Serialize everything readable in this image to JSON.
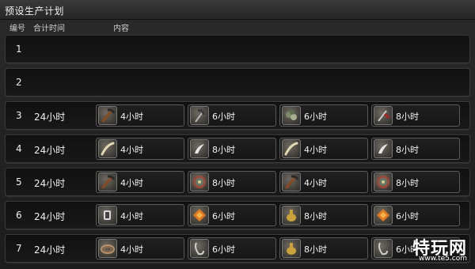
{
  "window": {
    "title": "预设生产计划"
  },
  "headers": {
    "num": "编号",
    "time": "合计时间",
    "content": "内容"
  },
  "rows": [
    {
      "num": "1",
      "total": "",
      "items": []
    },
    {
      "num": "2",
      "total": "",
      "items": []
    },
    {
      "num": "3",
      "total": "24小时",
      "items": [
        {
          "icon": "pickaxe-icon",
          "label": "4小时"
        },
        {
          "icon": "scythe-icon",
          "label": "6小时"
        },
        {
          "icon": "ore-icon",
          "label": "6小时"
        },
        {
          "icon": "red-feather-icon",
          "label": "8小时"
        }
      ]
    },
    {
      "num": "4",
      "total": "24小时",
      "items": [
        {
          "icon": "horn-icon",
          "label": "4小时"
        },
        {
          "icon": "fang-icon",
          "label": "8小时"
        },
        {
          "icon": "horn-icon",
          "label": "4小时"
        },
        {
          "icon": "fang-icon",
          "label": "8小时"
        }
      ]
    },
    {
      "num": "5",
      "total": "24小时",
      "items": [
        {
          "icon": "pickaxe-icon",
          "label": "4小时"
        },
        {
          "icon": "disc-icon",
          "label": "8小时"
        },
        {
          "icon": "pickaxe-icon",
          "label": "4小时"
        },
        {
          "icon": "disc-icon",
          "label": "8小时"
        }
      ]
    },
    {
      "num": "6",
      "total": "24小时",
      "items": [
        {
          "icon": "gauntlet-icon",
          "label": "4小时"
        },
        {
          "icon": "orange-gem-icon",
          "label": "6小时"
        },
        {
          "icon": "gold-vase-icon",
          "label": "8小时"
        },
        {
          "icon": "orange-gem-icon",
          "label": "6小时"
        }
      ]
    },
    {
      "num": "7",
      "total": "24小时",
      "items": [
        {
          "icon": "coiled-rope-icon",
          "label": "4小时"
        },
        {
          "icon": "wire-hook-icon",
          "label": "6小时"
        },
        {
          "icon": "gold-vase-icon",
          "label": "8小时"
        },
        {
          "icon": "wire-hook-icon",
          "label": "6小时"
        }
      ]
    }
  ],
  "watermark": {
    "main": "特玩网",
    "sub": "www.te5.com"
  }
}
